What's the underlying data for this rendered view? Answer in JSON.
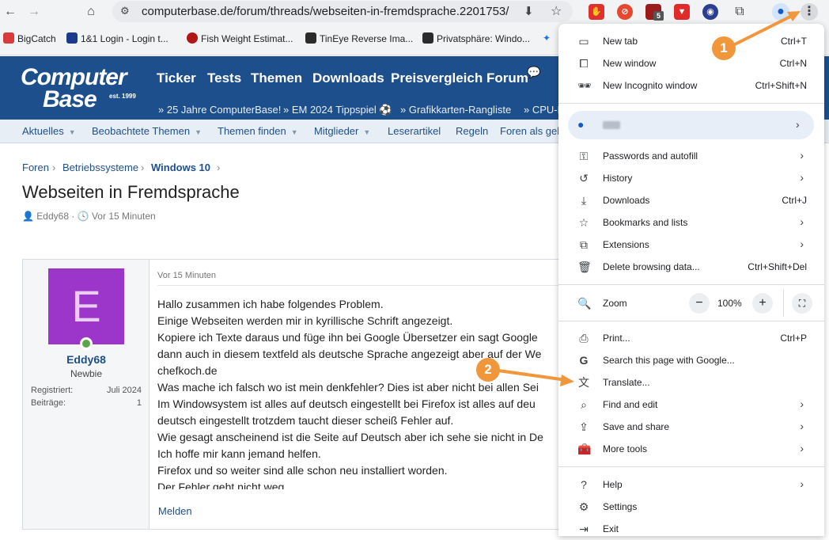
{
  "browser": {
    "url": "computerbase.de/forum/threads/webseiten-in-fremdsprache.2201753/",
    "ext_badge": "5",
    "bookmarks": [
      {
        "label": "BigCatch",
        "color": "#d83b3b"
      },
      {
        "label": "1&1 Login - Login t...",
        "color": "#1a3a8c"
      },
      {
        "label": "Fish Weight Estimat...",
        "color": "#b01818"
      },
      {
        "label": "TinEye Reverse Ima...",
        "color": "#2b2b2b"
      },
      {
        "label": "Privatsphäre: Windo...",
        "color": "#2b2b2b"
      }
    ]
  },
  "site": {
    "logo_line1": "Computer",
    "logo_line2": "Base",
    "logo_est": "est. 1999",
    "nav": [
      "Ticker",
      "Tests",
      "Themen",
      "Downloads",
      "Preisvergleich",
      "Forum"
    ],
    "sub_links": [
      "25 Jahre ComputerBase!",
      "EM 2024 Tippspiel",
      "Grafikkarten-Rangliste",
      "CPU-R"
    ],
    "sub_nav": [
      "Aktuelles",
      "Beobachtete Themen",
      "Themen finden",
      "Mitglieder",
      "Leserartikel",
      "Regeln",
      "Foren als gel"
    ]
  },
  "thread": {
    "breadcrumbs": [
      "Foren",
      "Betriebssysteme",
      "Windows 10"
    ],
    "title": "Webseiten in Fremdsprache",
    "author": "Eddy68",
    "time": "Vor 15 Minuten"
  },
  "post": {
    "avatar_letter": "E",
    "username": "Eddy68",
    "usertitle": "Newbie",
    "registered_label": "Registriert:",
    "registered_value": "Juli 2024",
    "posts_label": "Beiträge:",
    "posts_value": "1",
    "date": "Vor 15 Minuten",
    "lines": [
      "Hallo zusammen ich habe folgendes Problem.",
      "Einige Webseiten werden mir in kyrillische Schrift angezeigt.",
      "Kopiere ich Texte daraus und füge ihn bei Google Übersetzer ein sagt Google",
      "dann auch in diesem textfeld als deutsche Sprache angezeigt aber auf der We",
      "chefkoch.de",
      "Was mache ich falsch wo ist mein denkfehler? Dies ist aber nicht bei allen Sei",
      "Im Windowsystem ist alles auf deutsch eingestellt bei Firefox ist alles auf deu",
      "deutsch eingestellt trotzdem taucht dieser scheiß Fehler auf.",
      "Wie gesagt anscheinend ist die Seite auf Deutsch aber ich sehe sie nicht in De",
      "Ich hoffe mir kann jemand helfen.",
      "Firefox und so weiter sind alle schon neu installiert worden.",
      "Der Fehler geht nicht weg."
    ],
    "report": "Melden"
  },
  "menu": {
    "new_tab": "New tab",
    "new_tab_sc": "Ctrl+T",
    "new_window": "New window",
    "new_window_sc": "Ctrl+N",
    "incognito": "New Incognito window",
    "incognito_sc": "Ctrl+Shift+N",
    "passwords": "Passwords and autofill",
    "history": "History",
    "downloads": "Downloads",
    "downloads_sc": "Ctrl+J",
    "bookmarks": "Bookmarks and lists",
    "extensions": "Extensions",
    "delete": "Delete browsing data...",
    "delete_sc": "Ctrl+Shift+Del",
    "zoom": "Zoom",
    "zoom_value": "100%",
    "print": "Print...",
    "print_sc": "Ctrl+P",
    "search_google": "Search this page with Google...",
    "translate": "Translate...",
    "find": "Find and edit",
    "save": "Save and share",
    "more_tools": "More tools",
    "help": "Help",
    "settings": "Settings",
    "exit": "Exit"
  },
  "annotations": {
    "badge1": "1",
    "badge2": "2",
    "color": "#f0973c"
  }
}
